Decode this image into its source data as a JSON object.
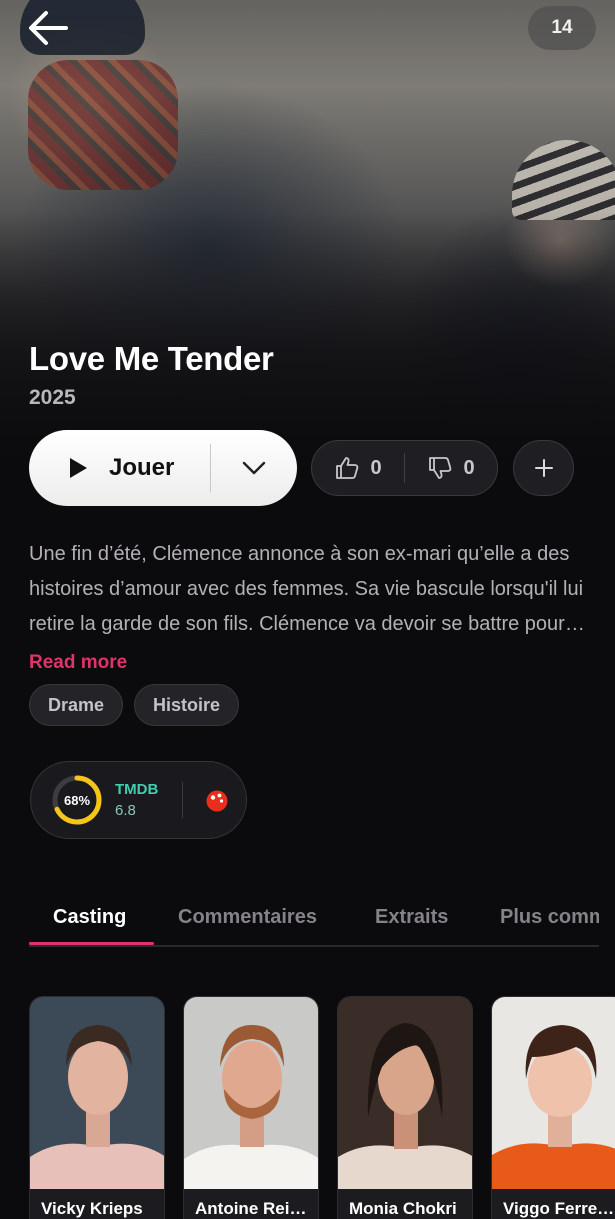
{
  "header": {
    "age_rating": "14"
  },
  "movie": {
    "title": "Love Me Tender",
    "year": "2025",
    "description": "Une fin d’été, Clémence annonce à son ex-mari qu’elle a des histoires d’amour avec des femmes. Sa vie bascule lorsqu'il lui retire la garde de son fils. Clémence va devoir se battre pour obtenir le droit de voir son enfant.",
    "read_more": "Read more",
    "genres": [
      "Drame",
      "Histoire"
    ]
  },
  "actions": {
    "play_label": "Jouer",
    "likes": "0",
    "dislikes": "0"
  },
  "ratings": {
    "percent_label": "68%",
    "percent_value": 0.68,
    "source": "TMDB",
    "score": "6.8",
    "ring_color": "#f5c518",
    "accent": "#e0336b"
  },
  "tabs": [
    {
      "label": "Casting"
    },
    {
      "label": "Commentaires"
    },
    {
      "label": "Extraits"
    },
    {
      "label": "Plus comme ceci"
    }
  ],
  "cast": [
    {
      "name": "Vicky Krieps"
    },
    {
      "name": "Antoine Reinartz"
    },
    {
      "name": "Monia Chokri"
    },
    {
      "name": "Viggo Ferreira-Redier"
    }
  ]
}
